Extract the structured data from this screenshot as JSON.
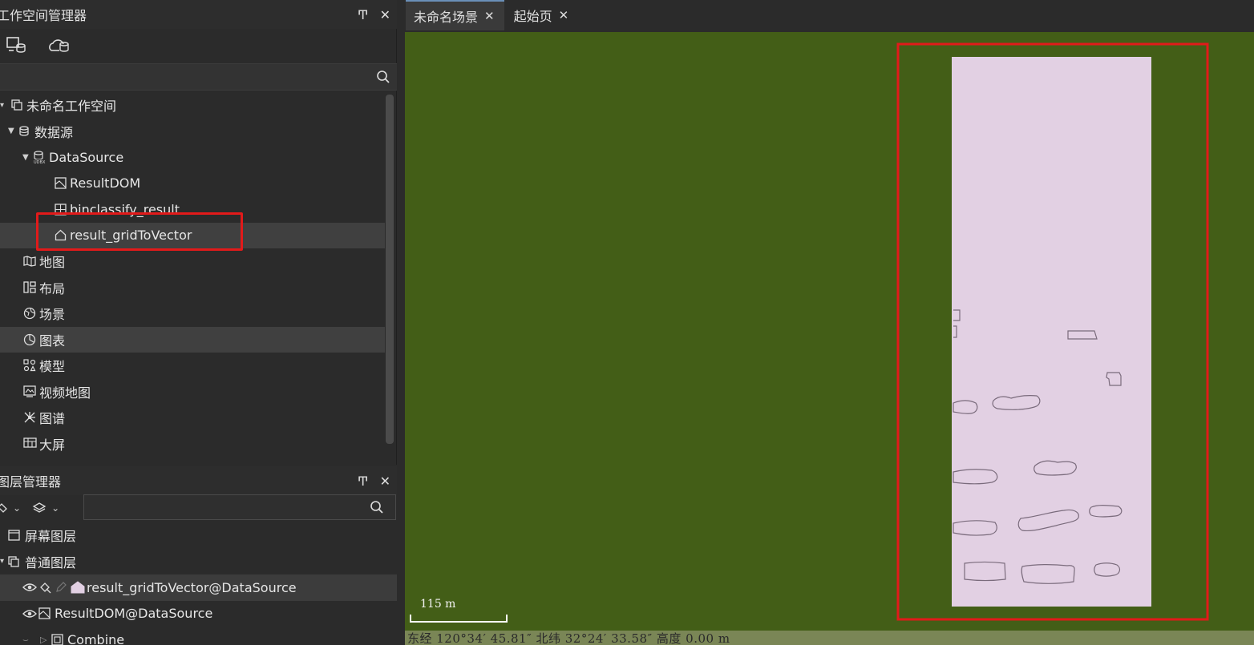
{
  "workspace_panel": {
    "title": "工作空间管理器",
    "pin": "Ͳ",
    "close": "✕",
    "tree": [
      {
        "label": "未命名工作空间",
        "level": 0,
        "icon": "workspace-icon"
      },
      {
        "label": "数据源",
        "level": 1,
        "icon": "datasources-icon"
      },
      {
        "label": "DataSource",
        "level": 2,
        "icon": "udbx-datasource-icon"
      },
      {
        "label": "ResultDOM",
        "level": 3,
        "icon": "raster-dataset-icon"
      },
      {
        "label": "binclassify_result",
        "level": 3,
        "icon": "grid-dataset-icon"
      },
      {
        "label": "result_gridToVector",
        "level": 3,
        "icon": "region-dataset-icon"
      },
      {
        "label": "地图",
        "level": 1,
        "icon": "map-icon"
      },
      {
        "label": "布局",
        "level": 1,
        "icon": "layout-icon"
      },
      {
        "label": "场景",
        "level": 1,
        "icon": "scene-icon"
      },
      {
        "label": "图表",
        "level": 1,
        "icon": "chart-icon"
      },
      {
        "label": "模型",
        "level": 1,
        "icon": "model-icon"
      },
      {
        "label": "视频地图",
        "level": 1,
        "icon": "video-map-icon"
      },
      {
        "label": "图谱",
        "level": 1,
        "icon": "graph-icon"
      },
      {
        "label": "大屏",
        "level": 1,
        "icon": "dashboard-icon"
      }
    ]
  },
  "layer_panel": {
    "title": "图层管理器",
    "pin": "Ͳ",
    "close": "✕",
    "layers": [
      {
        "label": "屏幕图层",
        "icon": "screen-layer-icon"
      },
      {
        "label": "普通图层",
        "icon": "normal-layer-icon"
      },
      {
        "label": "result_gridToVector@DataSource",
        "icon": "region-layer-icon"
      },
      {
        "label": "ResultDOM@DataSource",
        "icon": "raster-layer-icon"
      },
      {
        "label": "Combine",
        "icon": "combine-layer-icon"
      }
    ]
  },
  "tabs": [
    {
      "label": "未命名场景",
      "close": "✕"
    },
    {
      "label": "起始页",
      "close": "✕"
    }
  ],
  "scene": {
    "scale_label": "115  m",
    "status": "东经  120°34′  45.81″   北纬  32°24′  33.58″   高度  0.00  m"
  },
  "colors": {
    "scene_bg": "#435e17",
    "region_fill": "#e2d0e3",
    "highlight": "#e21a1a"
  }
}
